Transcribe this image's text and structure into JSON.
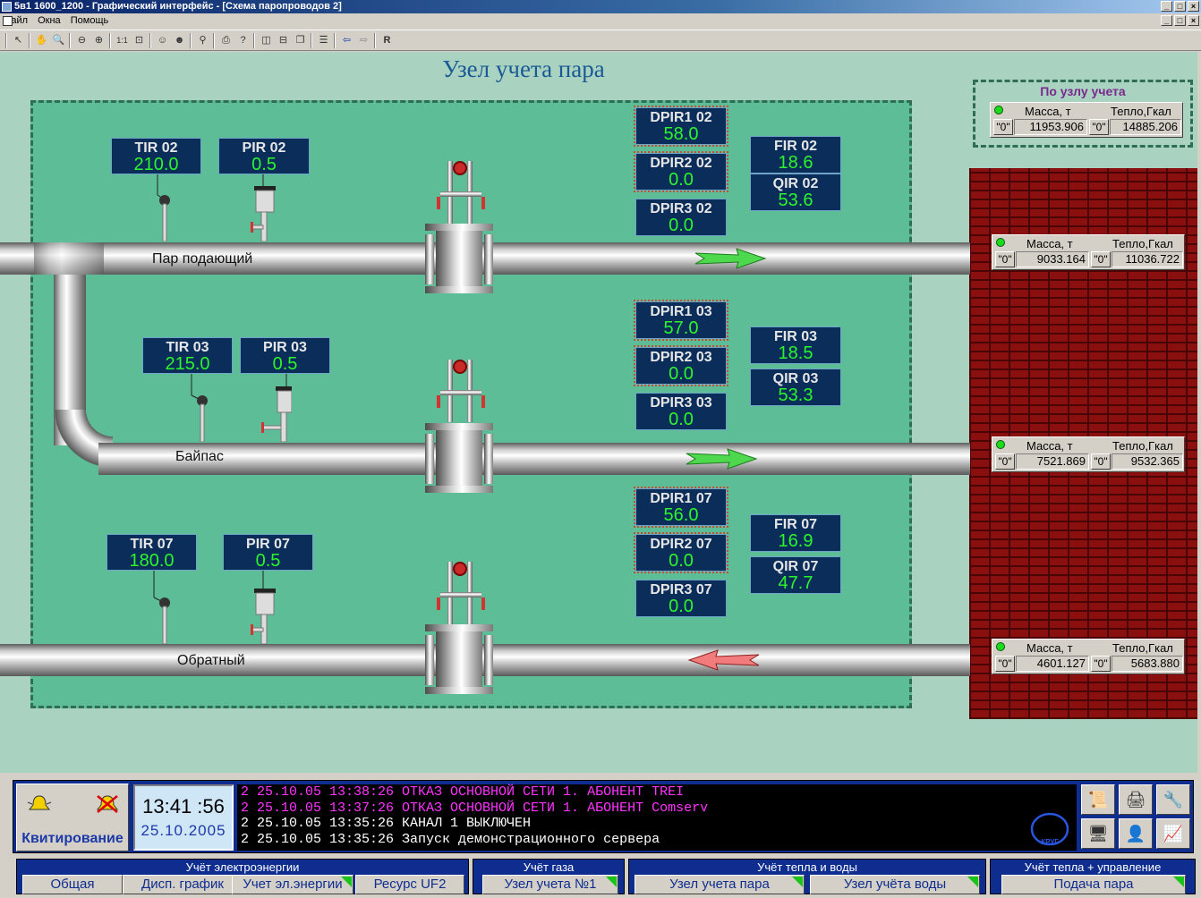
{
  "window": {
    "title": "5в1 1600_1200 - Графический интерфейс - [Схема паропроводов 2]"
  },
  "menu": [
    "Файл",
    "Окна",
    "Помощь"
  ],
  "scene": {
    "title": "Узел учета пара",
    "pipes": {
      "supply": "Пар подающий",
      "bypass": "Байпас",
      "return": "Обратный"
    },
    "summary": {
      "title": "По узлу учета",
      "mass_label": "Масса, т",
      "heat_label": "Тепло,Гкал",
      "q": "\"0\"",
      "mass": "11953.906",
      "heat": "14885.206"
    },
    "meters": [
      {
        "mass_label": "Масса, т",
        "heat_label": "Тепло,Гкал",
        "q": "\"0\"",
        "mass": "9033.164",
        "heat": "11036.722"
      },
      {
        "mass_label": "Масса, т",
        "heat_label": "Тепло,Гкал",
        "q": "\"0\"",
        "mass": "7521.869",
        "heat": "9532.365"
      },
      {
        "mass_label": "Масса, т",
        "heat_label": "Тепло,Гкал",
        "q": "\"0\"",
        "mass": "4601.127",
        "heat": "5683.880"
      }
    ],
    "tags": {
      "tir02": {
        "name": "TIR 02",
        "value": "210.0"
      },
      "pir02": {
        "name": "PIR 02",
        "value": "0.5"
      },
      "tir03": {
        "name": "TIR 03",
        "value": "215.0"
      },
      "pir03": {
        "name": "PIR 03",
        "value": "0.5"
      },
      "tir07": {
        "name": "TIR 07",
        "value": "180.0"
      },
      "pir07": {
        "name": "PIR 07",
        "value": "0.5"
      },
      "dpir1_02": {
        "name": "DPIR1 02",
        "value": "58.0"
      },
      "dpir2_02": {
        "name": "DPIR2 02",
        "value": "0.0"
      },
      "dpir3_02": {
        "name": "DPIR3 02",
        "value": "0.0"
      },
      "dpir1_03": {
        "name": "DPIR1 03",
        "value": "57.0"
      },
      "dpir2_03": {
        "name": "DPIR2 03",
        "value": "0.0"
      },
      "dpir3_03": {
        "name": "DPIR3 03",
        "value": "0.0"
      },
      "dpir1_07": {
        "name": "DPIR1 07",
        "value": "56.0"
      },
      "dpir2_07": {
        "name": "DPIR2 07",
        "value": "0.0"
      },
      "dpir3_07": {
        "name": "DPIR3 07",
        "value": "0.0"
      },
      "fir02": {
        "name": "FIR 02",
        "value": "18.6"
      },
      "qir02": {
        "name": "QIR 02",
        "value": "53.6"
      },
      "fir03": {
        "name": "FIR 03",
        "value": "18.5"
      },
      "qir03": {
        "name": "QIR 03",
        "value": "53.3"
      },
      "fir07": {
        "name": "FIR 07",
        "value": "16.9"
      },
      "qir07": {
        "name": "QIR 07",
        "value": "47.7"
      }
    }
  },
  "bottom": {
    "ack_label": "Квитирование",
    "time": "13:41 :56",
    "date": "25.10.2005",
    "logo_text": "КРУГ",
    "log": [
      {
        "text": "2  25.10.05 13:38:26 ОТКАЗ ОСНОВНОЙ СЕТИ 1. АБОНЕНТ TREI",
        "color": "#ff33ff"
      },
      {
        "text": "2  25.10.05 13:37:26 ОТКАЗ ОСНОВНОЙ СЕТИ 1. АБОНЕНТ Comserv",
        "color": "#ff33ff"
      },
      {
        "text": "2  25.10.05 13:35:26 КАНАЛ 1 ВЫКЛЮЧЕН",
        "color": "#ffffff"
      },
      {
        "text": "2  25.10.05 13:35:26 Запуск демонстрационного сервера",
        "color": "#ffffff"
      }
    ],
    "groups": {
      "electric": {
        "title": "Учёт электроэнергии",
        "buttons": [
          "Общая",
          "Дисп. график",
          "Учет эл.энергии",
          "Ресурс UF2"
        ]
      },
      "gas": {
        "title": "Учёт газа",
        "buttons": [
          "Узел учета №1"
        ]
      },
      "heat": {
        "title": "Учёт тепла и воды",
        "buttons": [
          "Узел учета пара",
          "Узел учёта воды"
        ]
      },
      "control": {
        "title": "Учёт тепла + управление",
        "buttons": [
          "Подача пара"
        ]
      }
    }
  }
}
